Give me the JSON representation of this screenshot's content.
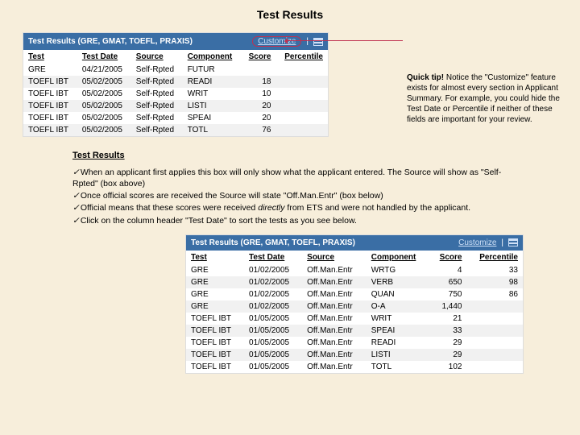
{
  "page_title": "Test Results",
  "table1": {
    "title": "Test Results (GRE, GMAT, TOEFL, PRAXIS)",
    "customize": "Customize",
    "headers": [
      "Test",
      "Test Date",
      "Source",
      "Component",
      "Score",
      "Percentile"
    ],
    "rows": [
      [
        "GRE",
        "04/21/2005",
        "Self-Rpted",
        "FUTUR",
        "",
        ""
      ],
      [
        "TOEFL IBT",
        "05/02/2005",
        "Self-Rpted",
        "READI",
        "18",
        ""
      ],
      [
        "TOEFL IBT",
        "05/02/2005",
        "Self-Rpted",
        "WRIT",
        "10",
        ""
      ],
      [
        "TOEFL IBT",
        "05/02/2005",
        "Self-Rpted",
        "LISTI",
        "20",
        ""
      ],
      [
        "TOEFL IBT",
        "05/02/2005",
        "Self-Rpted",
        "SPEAI",
        "20",
        ""
      ],
      [
        "TOEFL IBT",
        "05/02/2005",
        "Self-Rpted",
        "TOTL",
        "76",
        ""
      ]
    ]
  },
  "tip": {
    "lead": "Quick tip!",
    "text": " Notice the \"Customize\" feature exists for almost every section in Applicant Summary. For example, you could hide the Test Date or Percentile if neither of these fields are important for your review."
  },
  "notes": {
    "heading": "Test Results",
    "items": [
      "When an applicant first applies this box will only show what the applicant entered. The Source will show as \"Self-Rpted\" (box above)",
      "Once official scores are received the Source will state \"Off.Man.Entr\" (box below)",
      "Official means that these scores were received <em>directly</em> from ETS and were not handled by the applicant.",
      "Click on the column header \"Test Date\" to sort the tests as you see below."
    ]
  },
  "table2": {
    "title": "Test Results (GRE, GMAT, TOEFL, PRAXIS)",
    "customize": "Customize",
    "headers": [
      "Test",
      "Test Date",
      "Source",
      "Component",
      "Score",
      "Percentile"
    ],
    "rows": [
      [
        "GRE",
        "01/02/2005",
        "Off.Man.Entr",
        "WRTG",
        "4",
        "33"
      ],
      [
        "GRE",
        "01/02/2005",
        "Off.Man.Entr",
        "VERB",
        "650",
        "98"
      ],
      [
        "GRE",
        "01/02/2005",
        "Off.Man.Entr",
        "QUAN",
        "750",
        "86"
      ],
      [
        "GRE",
        "01/02/2005",
        "Off.Man.Entr",
        "O-A",
        "1,440",
        ""
      ],
      [
        "TOEFL IBT",
        "01/05/2005",
        "Off.Man.Entr",
        "WRIT",
        "21",
        ""
      ],
      [
        "TOEFL IBT",
        "01/05/2005",
        "Off.Man.Entr",
        "SPEAI",
        "33",
        ""
      ],
      [
        "TOEFL IBT",
        "01/05/2005",
        "Off.Man.Entr",
        "READI",
        "29",
        ""
      ],
      [
        "TOEFL IBT",
        "01/05/2005",
        "Off.Man.Entr",
        "LISTI",
        "29",
        ""
      ],
      [
        "TOEFL IBT",
        "01/05/2005",
        "Off.Man.Entr",
        "TOTL",
        "102",
        ""
      ]
    ]
  }
}
